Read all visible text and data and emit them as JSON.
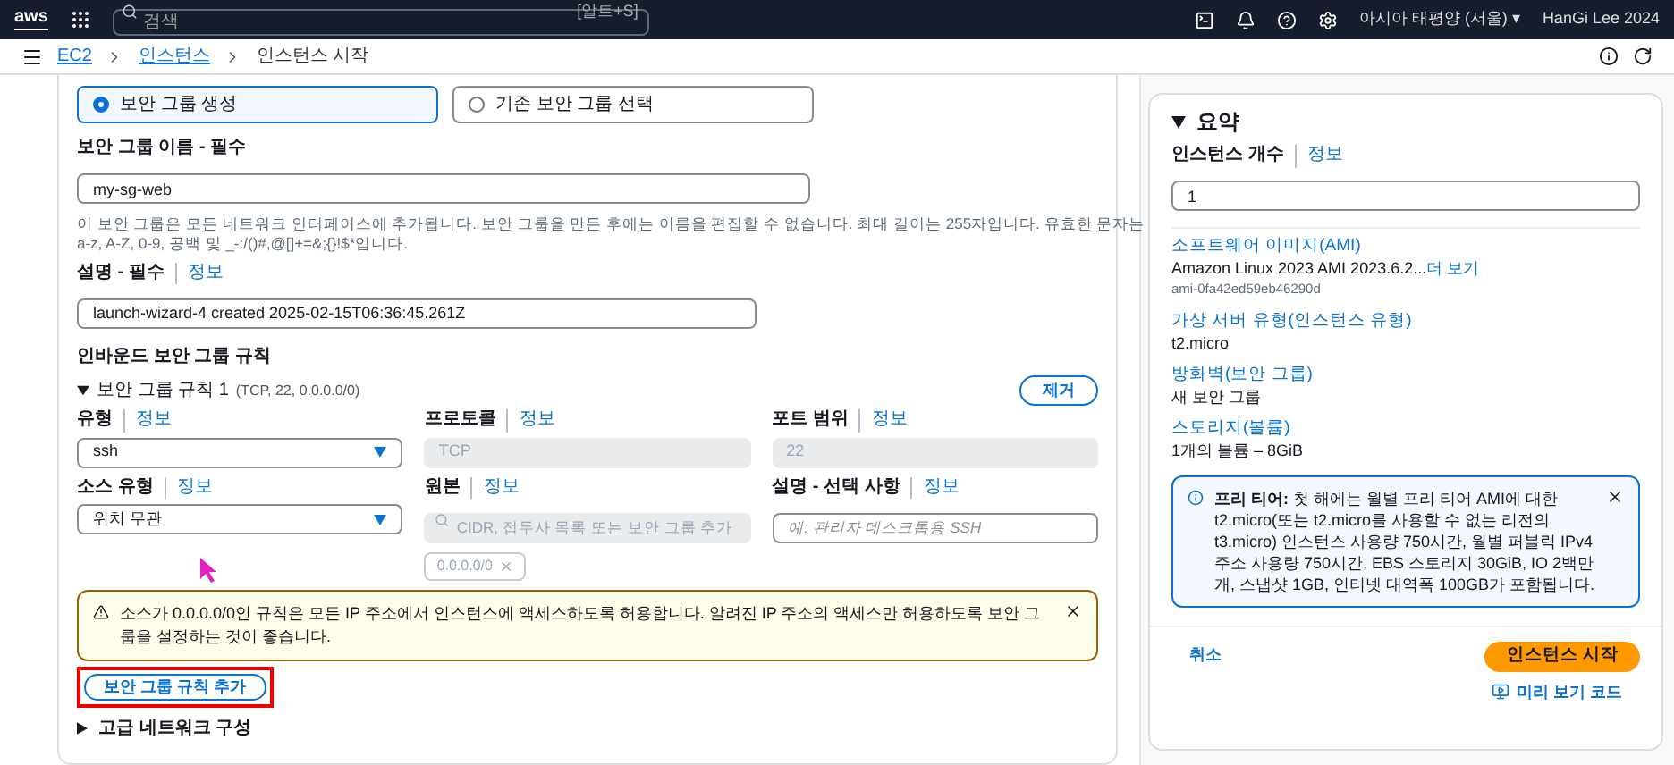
{
  "header": {
    "logo": "aws",
    "search_placeholder": "검색",
    "shortcut": "[알트+S]",
    "region": "아시아 태평양 (서울) ▾",
    "user": "HanGi Lee 2024"
  },
  "breadcrumbs": [
    {
      "label": "EC2",
      "kind": "link"
    },
    {
      "label": "인스턴스",
      "kind": "link"
    },
    {
      "label": "인스턴스 시작",
      "kind": "current"
    }
  ],
  "security_group": {
    "options": [
      {
        "label": "보안 그룹 생성",
        "selected": true
      },
      {
        "label": "기존 보안 그룹 선택",
        "selected": false
      }
    ],
    "name": {
      "label": "보안 그룹 이름 - 필수",
      "value": "my-sg-web",
      "hint": "이 보안 그룹은 모든 네트워크 인터페이스에 추가됩니다. 보안 그룹을 만든 후에는 이름을 편집할 수 없습니다. 최대 길이는 255자입니다. 유효한 문자는 a-z, A-Z, 0-9, 공백 및 _-:/()#,@[]+=&;{}!$*입니다."
    },
    "description": {
      "label": "설명 - 필수",
      "info": "정보",
      "value": "launch-wizard-4 created 2025-02-15T06:36:45.261Z"
    },
    "inbound_title": "인바운드 보안 그룹 규칙",
    "rule": {
      "title": "보안 그룹 규칙 1",
      "detail": "(TCP, 22, 0.0.0.0/0)",
      "expanded": true,
      "remove_button": "제거",
      "fields": [
        {
          "kind": "select",
          "label": "유형",
          "info": "정보",
          "value": "ssh"
        },
        {
          "kind": "readonly",
          "label": "프로토콜",
          "info": "정보",
          "value": "TCP"
        },
        {
          "kind": "readonly",
          "label": "포트 범위",
          "info": "정보",
          "value": "22"
        },
        {
          "kind": "select",
          "label": "소스 유형",
          "info": "정보",
          "value": "위치 무관"
        },
        {
          "kind": "search",
          "label": "원본",
          "info": "정보",
          "placeholder": "CIDR, 접두사 목록 또는 보안 그룹 추가"
        },
        {
          "kind": "input",
          "label": "설명 - 선택 사항",
          "info": "정보",
          "placeholder": "예: 관리자 데스크톱용 SSH"
        }
      ],
      "chip": "0.0.0.0/0"
    },
    "warning": "소스가 0.0.0.0/0인 규칙은 모든 IP 주소에서 인스턴스에 액세스하도록 허용합니다. 알려진 IP 주소의 액세스만 허용하도록 보안 그룹을 설정하는 것이 좋습니다.",
    "add_button": "보안 그룹 규칙 추가",
    "advanced": {
      "title": "고급 네트워크 구성",
      "expanded": false
    }
  },
  "summary": {
    "title": "요약",
    "expanded": true,
    "count": {
      "label": "인스턴스 개수",
      "info": "정보",
      "value": "1"
    },
    "items": [
      {
        "title": "소프트웨어 이미지(AMI)",
        "value": "Amazon Linux 2023 AMI 2023.6.2...",
        "more": "더 보기",
        "sub": "ami-0fa42ed59eb46290d"
      },
      {
        "title": "가상 서버 유형(인스턴스 유형)",
        "value": "t2.micro"
      },
      {
        "title": "방화벽(보안 그룹)",
        "value": "새 보안 그룹"
      },
      {
        "title": "스토리지(볼륨)",
        "value": "1개의 볼륨 – 8GiB"
      }
    ],
    "notice": "**프리 티어:** 첫 해에는 월별 프리 티어 AMI에 대한 t2.micro(또는 t2.micro를 사용할 수 없는 리전의 t3.micro) 인스턴스 사용량 750시간, 월별 퍼블릭 IPv4 주소 사용량 750시간, EBS 스토리지 30GiB, IO 2백만 개, 스냅샷 1GB, 인터넷 대역폭 100GB가 포함됩니다.",
    "cancel": "취소",
    "launch": "인스턴스 시작",
    "preview": "미리 보기 코드"
  }
}
